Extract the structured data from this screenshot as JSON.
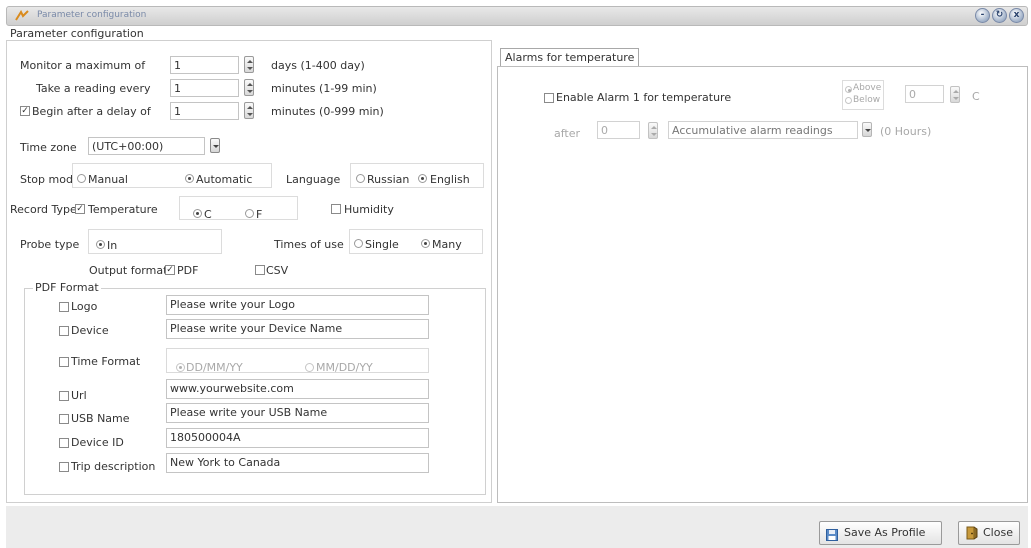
{
  "window": {
    "title": "Parameter configuration",
    "controls": [
      "-",
      "↻",
      "x"
    ]
  },
  "page_title": "Parameter configuration",
  "monitor": {
    "label": "Monitor a maximum of",
    "value": "1",
    "unit": "days (1-400 day)"
  },
  "reading": {
    "label": "Take a reading every",
    "value": "1",
    "unit": "minutes (1-99 min)"
  },
  "delay": {
    "label": "Begin after a delay of",
    "value": "1",
    "unit": "minutes (0-999 min)",
    "checked": true
  },
  "timezone": {
    "label": "Time zone",
    "value": "(UTC+00:00)"
  },
  "stop_mode": {
    "label": "Stop mode",
    "manual": "Manual",
    "automatic": "Automatic",
    "selected": "automatic"
  },
  "language": {
    "label": "Language",
    "russian": "Russian",
    "english": "English",
    "selected": "english"
  },
  "record_type": {
    "label": "Record Type",
    "temperature": "Temperature",
    "c": "C",
    "f": "F",
    "humidity": "Humidity"
  },
  "probe_type": {
    "label": "Probe type",
    "in": "In"
  },
  "times_of_use": {
    "label": "Times of use",
    "single": "Single",
    "many": "Many",
    "selected": "many"
  },
  "output_format": {
    "label": "Output format",
    "pdf": "PDF",
    "csv": "CSV"
  },
  "pdf_format": {
    "legend": "PDF Format",
    "logo": {
      "label": "Logo",
      "value": "Please write your Logo"
    },
    "device": {
      "label": "Device",
      "value": "Please write your Device Name"
    },
    "time_format": {
      "label": "Time Format",
      "opt1": "DD/MM/YY",
      "opt2": "MM/DD/YY"
    },
    "url": {
      "label": "Url",
      "value": "www.yourwebsite.com"
    },
    "usb_name": {
      "label": "USB Name",
      "value": "Please write your USB Name"
    },
    "device_id": {
      "label": "Device ID",
      "value": "180500004A"
    },
    "trip": {
      "label": "Trip description",
      "value": "New York to Canada"
    }
  },
  "alarm": {
    "tab": "Alarms for temperature",
    "enable_label": "Enable Alarm 1 for temperature",
    "above": "Above",
    "below": "Below",
    "threshold": "0",
    "unit": "C",
    "after_label": "after",
    "after_value": "0",
    "mode": "Accumulative alarm readings",
    "hours": "(0 Hours)"
  },
  "buttons": {
    "save_profile": "Save As Profile",
    "close": "Close"
  },
  "colors": {
    "window_bg": "#ffffff",
    "bottom_bar": "#ececec",
    "title_text": "#7a8aa8"
  }
}
